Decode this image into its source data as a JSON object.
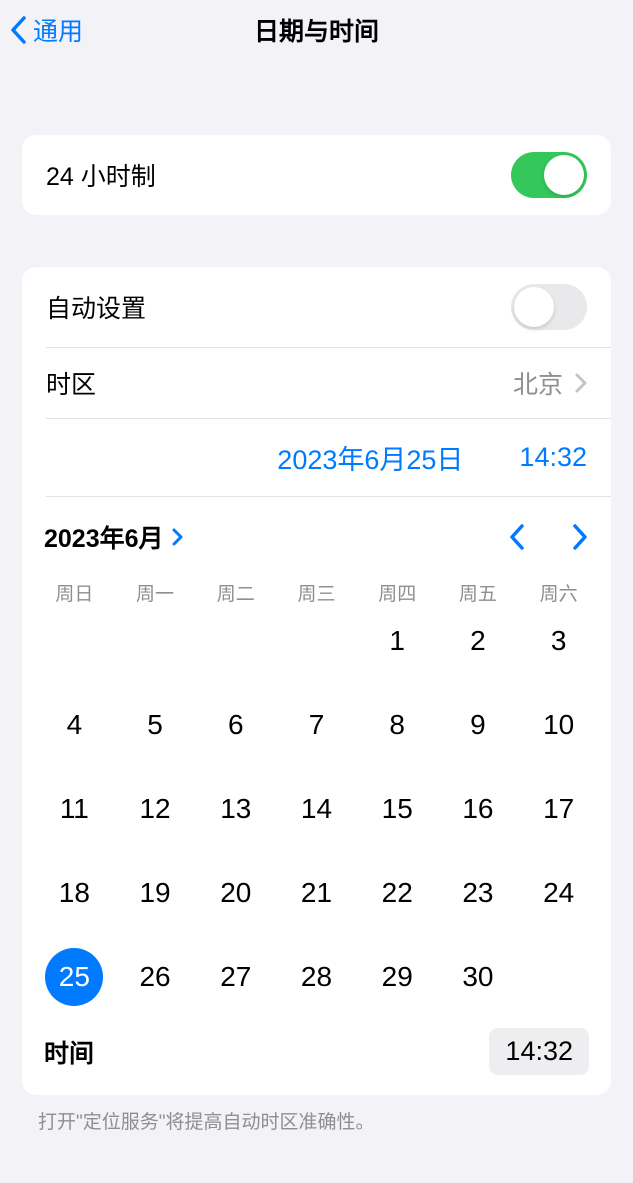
{
  "header": {
    "back_label": "通用",
    "title": "日期与时间"
  },
  "settings": {
    "twenty_four_hour": {
      "label": "24 小时制",
      "on": true
    },
    "auto_set": {
      "label": "自动设置",
      "on": false
    },
    "timezone": {
      "label": "时区",
      "value": "北京"
    }
  },
  "datetime": {
    "date_text": "2023年6月25日",
    "time_text": "14:32"
  },
  "calendar": {
    "month_label": "2023年6月",
    "weekdays": [
      "周日",
      "周一",
      "周二",
      "周三",
      "周四",
      "周五",
      "周六"
    ],
    "first_weekday": 4,
    "days_in_month": 30,
    "selected_day": 25,
    "time_label": "时间",
    "time_value": "14:32"
  },
  "footer": {
    "text": "打开\"定位服务\"将提高自动时区准确性。"
  },
  "colors": {
    "accent": "#007aff",
    "green": "#34c759",
    "gray": "#8e8e93"
  }
}
